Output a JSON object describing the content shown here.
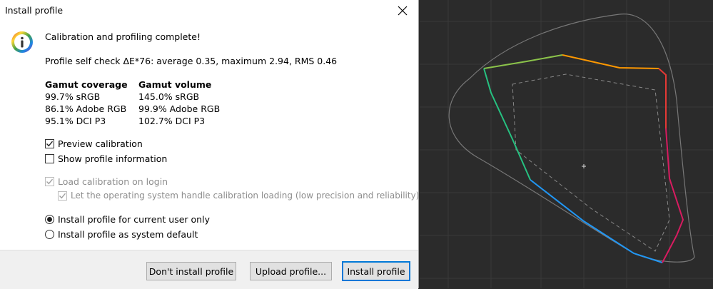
{
  "dialog": {
    "title": "Install profile",
    "heading": "Calibration and profiling complete!",
    "self_check": "Profile self check ΔE*76: average 0.35, maximum 2.94, RMS 0.46",
    "gamut_coverage": {
      "header": "Gamut coverage",
      "rows": [
        "99.7% sRGB",
        "86.1% Adobe RGB",
        "95.1% DCI P3"
      ]
    },
    "gamut_volume": {
      "header": "Gamut volume",
      "rows": [
        "145.0% sRGB",
        "99.9% Adobe RGB",
        "102.7% DCI P3"
      ]
    },
    "options": {
      "preview_calibration": {
        "label": "Preview calibration",
        "checked": true
      },
      "show_profile_info": {
        "label": "Show profile information",
        "checked": false
      },
      "load_on_login": {
        "label": "Load calibration on login",
        "checked": true,
        "enabled": false
      },
      "os_handle": {
        "label": "Let the operating system handle calibration loading (low precision and reliability)",
        "checked": true,
        "enabled": false
      }
    },
    "install_scope": {
      "current_user": {
        "label": "Install profile for current user only",
        "selected": true
      },
      "system_default": {
        "label": "Install profile as system default",
        "selected": false
      }
    },
    "buttons": {
      "dont_install": "Don't install profile",
      "upload": "Upload profile...",
      "install": "Install profile"
    }
  },
  "colors": {
    "plot_background": "#2b2b2b",
    "default_button_border": "#0078d7"
  }
}
